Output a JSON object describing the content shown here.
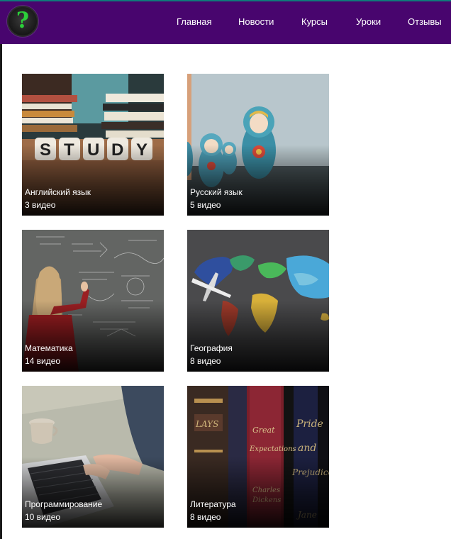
{
  "header": {
    "logo_glyph": "?",
    "nav": [
      "Главная",
      "Новости",
      "Курсы",
      "Уроки",
      "Отзывы"
    ]
  },
  "courses": [
    {
      "title": "Английский язык",
      "count": "3 видео",
      "image": "study-letter-cubes-and-books"
    },
    {
      "title": "Русский язык",
      "count": "5 видео",
      "image": "matryoshka-dolls"
    },
    {
      "title": "Математика",
      "count": "14 видео",
      "image": "woman-writing-on-chalkboard"
    },
    {
      "title": "География",
      "count": "8 видео",
      "image": "world-map-with-toy-plane"
    },
    {
      "title": "Программирование",
      "count": "10 видео",
      "image": "hands-typing-on-laptop"
    },
    {
      "title": "Литература",
      "count": "8 видео",
      "image": "old-book-spines"
    }
  ],
  "colors": {
    "header_bg": "#48056e",
    "header_border": "#0f7a7a",
    "logo_glyph": "#2ccf3a",
    "text": "#ffffff"
  }
}
